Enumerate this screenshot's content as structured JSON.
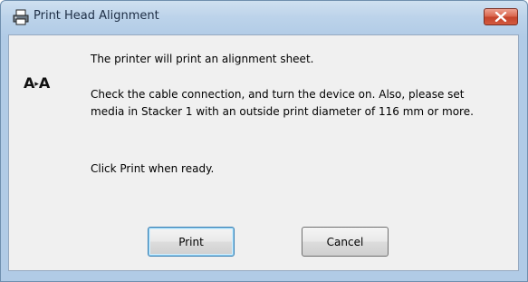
{
  "window": {
    "title": "Print Head Alignment"
  },
  "icon": {
    "name": "alignment-icon",
    "text_left": "A",
    "arrow": "▸",
    "text_right": "A"
  },
  "messages": {
    "line1": "The printer will print an alignment sheet.",
    "line2a": "Check the cable connection, and turn the device on. Also, please set",
    "line2b": "media in Stacker 1 with an outside print diameter of 116 mm or more.",
    "line3": "Click Print when ready."
  },
  "buttons": {
    "print_label": "Print",
    "cancel_label": "Cancel"
  },
  "colors": {
    "title_bar": "#bcd3ea",
    "close_button": "#d35a3f",
    "content_bg": "#f0f0f0",
    "default_button_border": "#3c7fb1"
  }
}
